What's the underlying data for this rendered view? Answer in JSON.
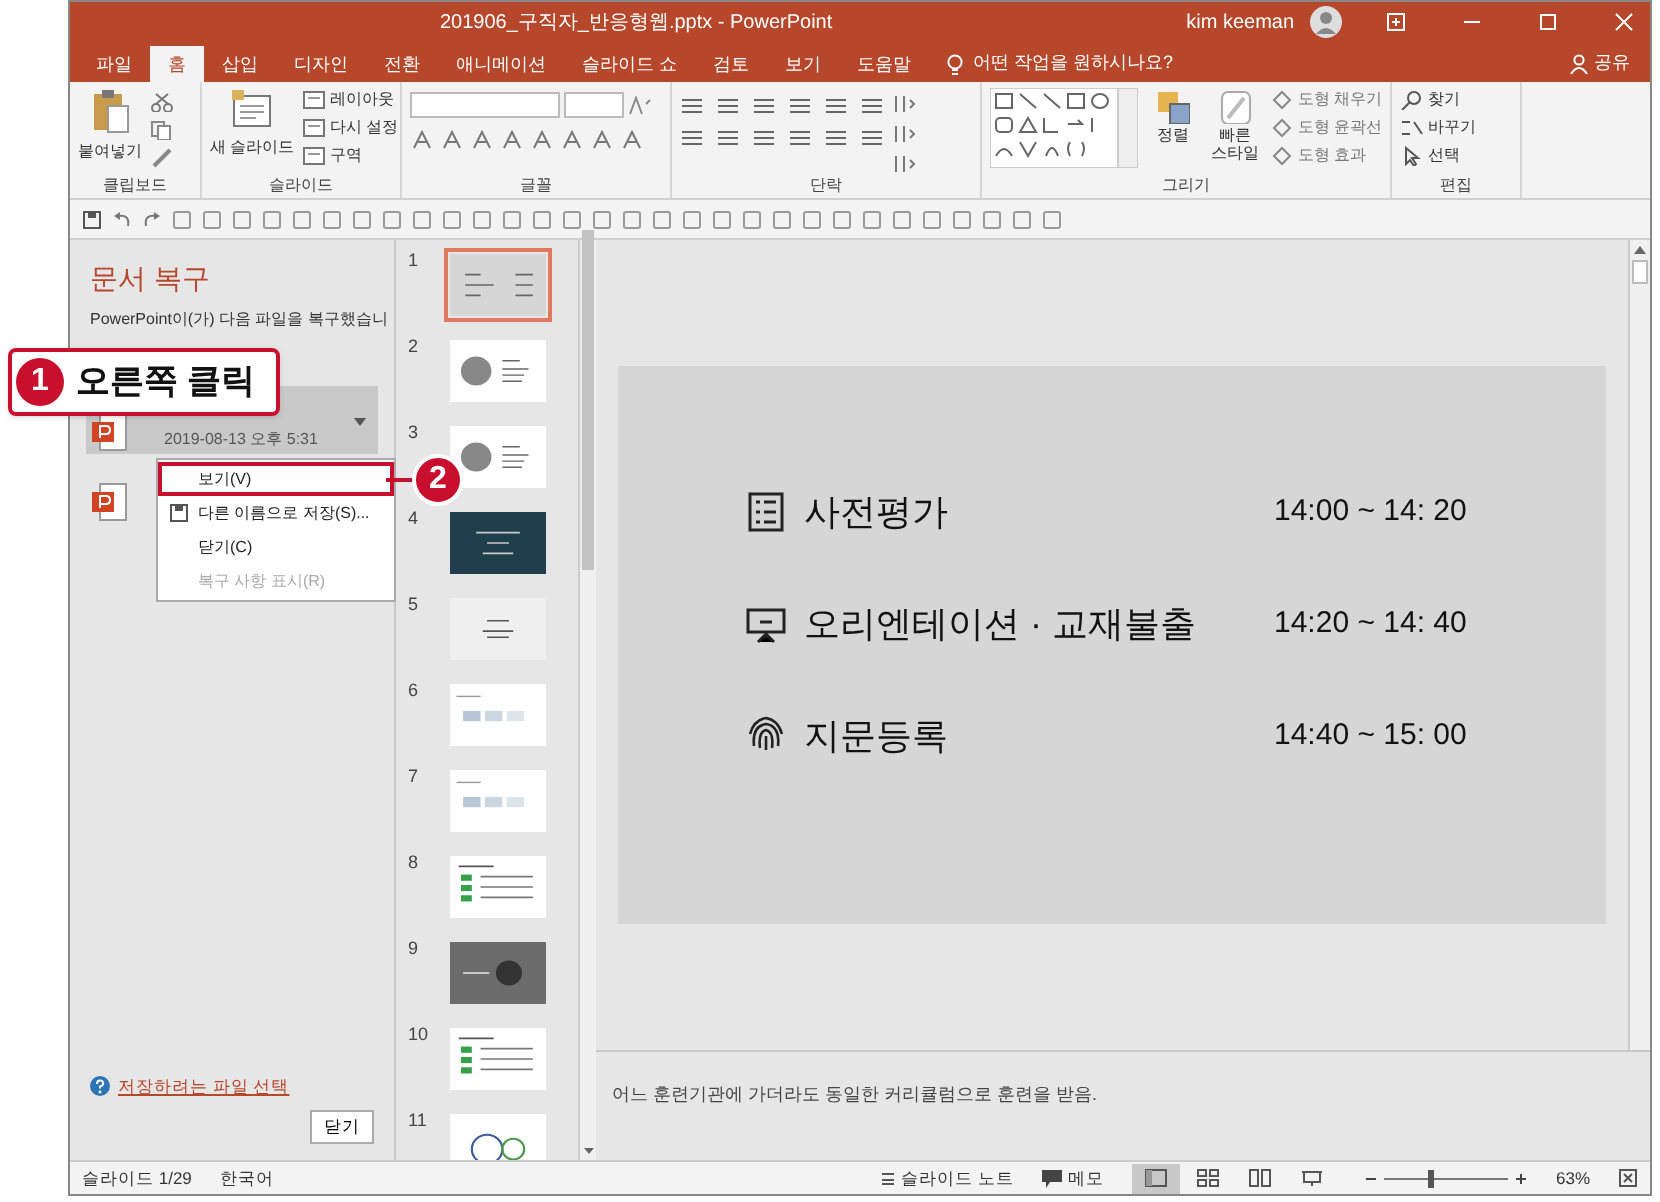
{
  "window": {
    "title": "201906_구직자_반응형웹.pptx  -  PowerPoint",
    "user": "kim keeman"
  },
  "tabs": [
    {
      "label": "파일",
      "selected": false
    },
    {
      "label": "홈",
      "selected": true
    },
    {
      "label": "삽입",
      "selected": false
    },
    {
      "label": "디자인",
      "selected": false
    },
    {
      "label": "전환",
      "selected": false
    },
    {
      "label": "애니메이션",
      "selected": false
    },
    {
      "label": "슬라이드 쇼",
      "selected": false
    },
    {
      "label": "검토",
      "selected": false
    },
    {
      "label": "보기",
      "selected": false
    },
    {
      "label": "도움말",
      "selected": false
    }
  ],
  "tell_me": "어떤 작업을 원하시나요?",
  "share": "공유",
  "ribbon": [
    {
      "kind": "clipboard",
      "label": "클립보드",
      "large": [
        "붙여넣기"
      ]
    },
    {
      "kind": "slides",
      "label": "슬라이드",
      "large": [
        "새 슬라이드"
      ],
      "small": [
        "레이아웃",
        "다시 설정",
        "구역"
      ]
    },
    {
      "kind": "font",
      "label": "글꼴"
    },
    {
      "kind": "paragraph",
      "label": "단락"
    },
    {
      "kind": "drawing",
      "label": "그리기",
      "large": [
        "정렬",
        "빠른 스타일"
      ],
      "small": [
        "도형 채우기",
        "도형 윤곽선",
        "도형 효과"
      ]
    },
    {
      "kind": "editing",
      "label": "편집",
      "small": [
        "찾기",
        "바꾸기",
        "선택"
      ]
    }
  ],
  "recovery": {
    "title": "문서 복구",
    "message": "PowerPoint이(가) 다음 파일을 복구했습니",
    "file_date": "2019-08-13 오후 5:31",
    "link": "저장하려는 파일 선택",
    "close": "닫기"
  },
  "context_menu": [
    {
      "label": "보기(V)",
      "disabled": false,
      "highlighted": true
    },
    {
      "label": "다른 이름으로 저장(S)...",
      "disabled": false,
      "highlighted": false
    },
    {
      "label": "닫기(C)",
      "disabled": false,
      "highlighted": false
    },
    {
      "label": "복구 사항 표시(R)",
      "disabled": true,
      "highlighted": false
    }
  ],
  "callouts": [
    {
      "number": "1",
      "text": "오른쪽 클릭"
    },
    {
      "number": "2"
    }
  ],
  "slides": [
    {
      "number": "1",
      "kind": "text",
      "selected": true
    },
    {
      "number": "2",
      "kind": "profile",
      "selected": false
    },
    {
      "number": "3",
      "kind": "profile",
      "selected": false
    },
    {
      "number": "4",
      "kind": "dark",
      "selected": false
    },
    {
      "number": "5",
      "kind": "title",
      "selected": false
    },
    {
      "number": "6",
      "kind": "diagram",
      "selected": false
    },
    {
      "number": "7",
      "kind": "diagram",
      "selected": false
    },
    {
      "number": "8",
      "kind": "table",
      "selected": false
    },
    {
      "number": "9",
      "kind": "grey",
      "selected": false
    },
    {
      "number": "10",
      "kind": "table",
      "selected": false
    },
    {
      "number": "11",
      "kind": "circles",
      "selected": false
    }
  ],
  "slide": {
    "rows": [
      {
        "kind": "test",
        "label": "사전평가",
        "time": "14:00 ~ 14: 20"
      },
      {
        "kind": "orientation",
        "label": "오리엔테이션 · 교재불출",
        "time": "14:20 ~ 14: 40"
      },
      {
        "kind": "registration",
        "label": "지문등록",
        "time": "14:40 ~ 15: 00"
      }
    ]
  },
  "notes": "어느 훈련기관에 가더라도 동일한 커리큘럼으로 훈련을 받음.",
  "status_bar": {
    "slide": "슬라이드 1/29",
    "language": "한국어",
    "notes": "슬라이드 노트",
    "comments": "메모",
    "views": [
      {
        "kind": "normal",
        "selected": true
      },
      {
        "kind": "sorter",
        "selected": false
      },
      {
        "kind": "reading",
        "selected": false
      },
      {
        "kind": "show",
        "selected": false
      }
    ],
    "zoom": {
      "level": 0.35
    },
    "zoom_label": "63%"
  }
}
